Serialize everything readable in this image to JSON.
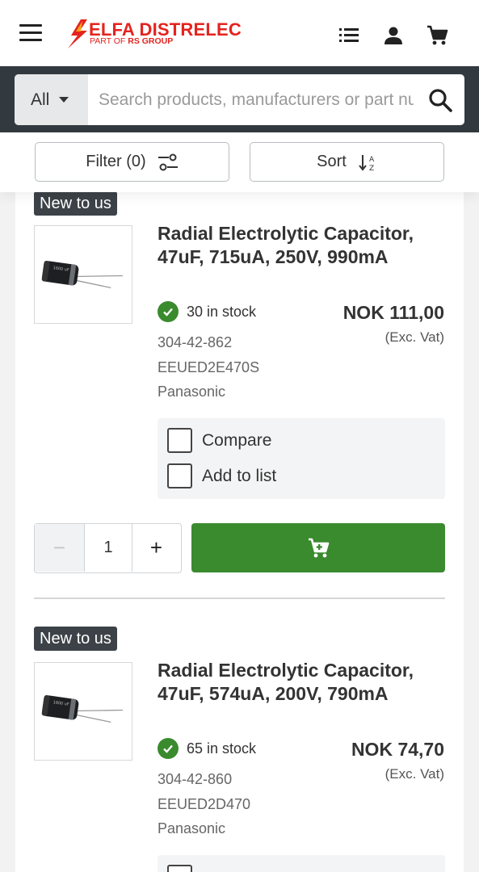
{
  "header": {
    "brand_name": "ELFA DISTRELEC",
    "brand_tag_prefix": "PART OF",
    "brand_tag_group": "RS GROUP",
    "brand_color": "#e4231f",
    "icons": [
      "hamburger-menu-icon",
      "list-icon",
      "account-icon",
      "cart-icon"
    ]
  },
  "search": {
    "category": "All",
    "placeholder": "Search products, manufacturers or part numbers"
  },
  "toolbar": {
    "filter_label": "Filter (0)",
    "sort_label": "Sort"
  },
  "products": [
    {
      "badge": "New to us",
      "title": "Radial Electrolytic Capacitor, 47uF, 715uA, 250V, 990mA",
      "stock": "30 in stock",
      "price": "NOK 111,00",
      "vat_note": "(Exc. Vat)",
      "article_number": "304-42-862",
      "mpn": "EEUED2E470S",
      "manufacturer": "Panasonic",
      "compare_label": "Compare",
      "add_to_list_label": "Add to list",
      "quantity": "1"
    },
    {
      "badge": "New to us",
      "title": "Radial Electrolytic Capacitor, 47uF, 574uA, 200V, 790mA",
      "stock": "65 in stock",
      "price": "NOK 74,70",
      "vat_note": "(Exc. Vat)",
      "article_number": "304-42-860",
      "mpn": "EEUED2D470",
      "manufacturer": "Panasonic"
    }
  ],
  "colors": {
    "accent_green": "#3a8a2e",
    "dark_bar": "#333a3f",
    "badge_bg": "#3c4247"
  }
}
